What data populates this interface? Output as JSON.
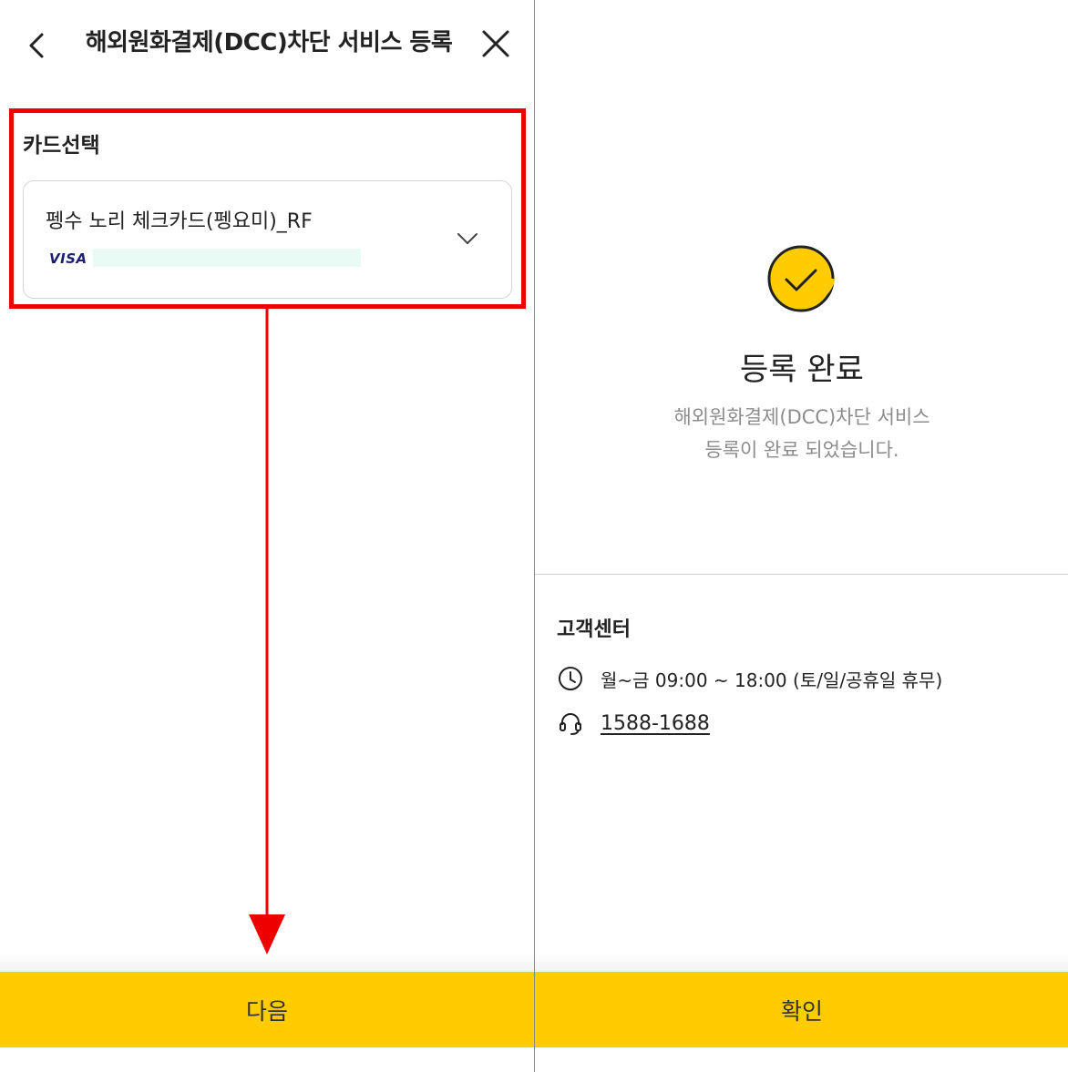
{
  "left_screen": {
    "header": {
      "title": "해외원화결제(DCC)차단 서비스 등록",
      "back_icon": "chevron-left-icon",
      "close_icon": "close-icon"
    },
    "card_select": {
      "label": "카드선택",
      "card_name": "펭수 노리 체크카드(펭요미)_RF",
      "card_brand": "VISA",
      "dropdown_icon": "chevron-down-icon"
    },
    "next_button": "다음",
    "annotation_color": "#ee0000"
  },
  "right_screen": {
    "status_icon": "check-circle-icon",
    "done_title": "등록 완료",
    "done_desc_line1": "해외원화결제(DCC)차단 서비스",
    "done_desc_line2": "등록이 완료 되었습니다.",
    "customer_center": {
      "title": "고객센터",
      "hours": "월~금 09:00 ~ 18:00 (토/일/공휴일 휴무)",
      "hours_icon": "clock-icon",
      "phone": "1588-1688",
      "phone_icon": "headset-icon"
    },
    "confirm_button": "확인"
  },
  "colors": {
    "accent": "#ffcc00",
    "highlight": "#ee0000"
  }
}
